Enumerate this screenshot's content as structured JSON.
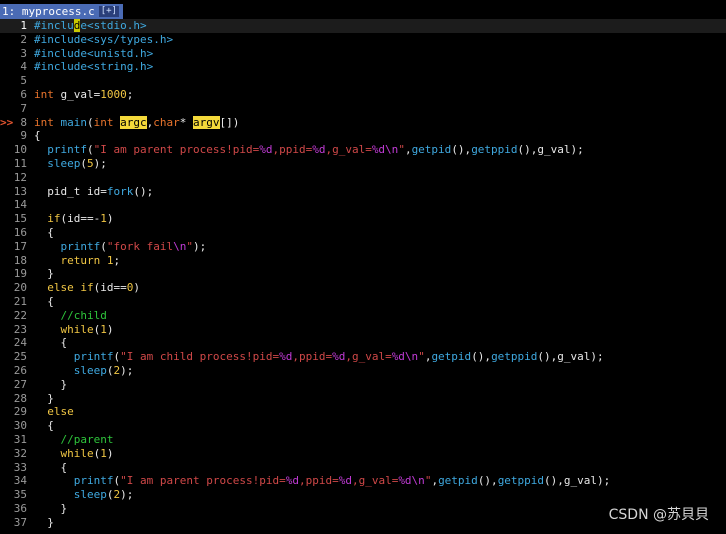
{
  "tabline": {
    "tab_label": "1: myprocess.c",
    "tab_flag": "[+]"
  },
  "editor": {
    "sign_glyph": ">>",
    "lines": [
      {
        "n": "1",
        "tokens": [
          [
            "pp",
            "#inclu"
          ],
          [
            "cur",
            "d"
          ],
          [
            "pp",
            "e"
          ],
          [
            "inc",
            "<stdio.h>"
          ]
        ]
      },
      {
        "n": "2",
        "tokens": [
          [
            "pp",
            "#include"
          ],
          [
            "inc",
            "<sys/types.h>"
          ]
        ]
      },
      {
        "n": "3",
        "tokens": [
          [
            "pp",
            "#include"
          ],
          [
            "inc",
            "<unistd.h>"
          ]
        ]
      },
      {
        "n": "4",
        "tokens": [
          [
            "pp",
            "#include"
          ],
          [
            "inc",
            "<string.h>"
          ]
        ]
      },
      {
        "n": "5",
        "tokens": []
      },
      {
        "n": "6",
        "tokens": [
          [
            "ty",
            "int"
          ],
          [
            "",
            " g_val="
          ],
          [
            "num",
            "1000"
          ],
          [
            "",
            ";"
          ]
        ]
      },
      {
        "n": "7",
        "tokens": []
      },
      {
        "n": "8",
        "sign": true,
        "tokens": [
          [
            "ty",
            "int"
          ],
          [
            "",
            " "
          ],
          [
            "fn",
            "main"
          ],
          [
            "",
            "("
          ],
          [
            "ty",
            "int"
          ],
          [
            "",
            " "
          ],
          [
            "hl",
            "argc"
          ],
          [
            "",
            ","
          ],
          [
            "ty",
            "char"
          ],
          [
            "",
            "* "
          ],
          [
            "hl",
            "argv"
          ],
          [
            "",
            "[])"
          ]
        ]
      },
      {
        "n": "9",
        "tokens": [
          [
            "",
            "{"
          ]
        ]
      },
      {
        "n": "10",
        "tokens": [
          [
            "",
            "  "
          ],
          [
            "fn",
            "printf"
          ],
          [
            "",
            "("
          ],
          [
            "str",
            "\"I am parent process!pid="
          ],
          [
            "esc",
            "%d"
          ],
          [
            "str",
            ",ppid="
          ],
          [
            "esc",
            "%d"
          ],
          [
            "str",
            ",g_val="
          ],
          [
            "esc",
            "%d\\n"
          ],
          [
            "str",
            "\""
          ],
          [
            "",
            ","
          ],
          [
            "fn",
            "getpid"
          ],
          [
            "",
            "(),"
          ],
          [
            "fn",
            "getppid"
          ],
          [
            "",
            "(),g_val);"
          ]
        ]
      },
      {
        "n": "11",
        "tokens": [
          [
            "",
            "  "
          ],
          [
            "fn",
            "sleep"
          ],
          [
            "",
            "("
          ],
          [
            "num",
            "5"
          ],
          [
            "",
            ");"
          ]
        ]
      },
      {
        "n": "12",
        "tokens": []
      },
      {
        "n": "13",
        "tokens": [
          [
            "",
            "  pid_t id="
          ],
          [
            "fn",
            "fork"
          ],
          [
            "",
            "();"
          ]
        ]
      },
      {
        "n": "14",
        "tokens": []
      },
      {
        "n": "15",
        "tokens": [
          [
            "",
            "  "
          ],
          [
            "kw",
            "if"
          ],
          [
            "",
            "(id==-"
          ],
          [
            "num",
            "1"
          ],
          [
            "",
            ")"
          ]
        ]
      },
      {
        "n": "16",
        "tokens": [
          [
            "",
            "  {"
          ]
        ]
      },
      {
        "n": "17",
        "tokens": [
          [
            "",
            "    "
          ],
          [
            "fn",
            "printf"
          ],
          [
            "",
            "("
          ],
          [
            "str",
            "\"fork fail"
          ],
          [
            "esc",
            "\\n"
          ],
          [
            "str",
            "\""
          ],
          [
            "",
            ");"
          ]
        ]
      },
      {
        "n": "18",
        "tokens": [
          [
            "",
            "    "
          ],
          [
            "kw",
            "return"
          ],
          [
            "",
            " "
          ],
          [
            "num",
            "1"
          ],
          [
            "",
            ";"
          ]
        ]
      },
      {
        "n": "19",
        "tokens": [
          [
            "",
            "  }"
          ]
        ]
      },
      {
        "n": "20",
        "tokens": [
          [
            "",
            "  "
          ],
          [
            "kw",
            "else"
          ],
          [
            "",
            " "
          ],
          [
            "kw",
            "if"
          ],
          [
            "",
            "(id=="
          ],
          [
            "num",
            "0"
          ],
          [
            "",
            ")"
          ]
        ]
      },
      {
        "n": "21",
        "tokens": [
          [
            "",
            "  {"
          ]
        ]
      },
      {
        "n": "22",
        "tokens": [
          [
            "",
            "    "
          ],
          [
            "cm",
            "//child"
          ]
        ]
      },
      {
        "n": "23",
        "tokens": [
          [
            "",
            "    "
          ],
          [
            "kw",
            "while"
          ],
          [
            "",
            "("
          ],
          [
            "num",
            "1"
          ],
          [
            "",
            ")"
          ]
        ]
      },
      {
        "n": "24",
        "tokens": [
          [
            "",
            "    {"
          ]
        ]
      },
      {
        "n": "25",
        "tokens": [
          [
            "",
            "      "
          ],
          [
            "fn",
            "printf"
          ],
          [
            "",
            "("
          ],
          [
            "str",
            "\"I am child process!pid="
          ],
          [
            "esc",
            "%d"
          ],
          [
            "str",
            ",ppid="
          ],
          [
            "esc",
            "%d"
          ],
          [
            "str",
            ",g_val="
          ],
          [
            "esc",
            "%d\\n"
          ],
          [
            "str",
            "\""
          ],
          [
            "",
            ","
          ],
          [
            "fn",
            "getpid"
          ],
          [
            "",
            "(),"
          ],
          [
            "fn",
            "getppid"
          ],
          [
            "",
            "(),g_val);"
          ]
        ]
      },
      {
        "n": "26",
        "tokens": [
          [
            "",
            "      "
          ],
          [
            "fn",
            "sleep"
          ],
          [
            "",
            "("
          ],
          [
            "num",
            "2"
          ],
          [
            "",
            ");"
          ]
        ]
      },
      {
        "n": "27",
        "tokens": [
          [
            "",
            "    }"
          ]
        ]
      },
      {
        "n": "28",
        "tokens": [
          [
            "",
            "  }"
          ]
        ]
      },
      {
        "n": "29",
        "tokens": [
          [
            "",
            "  "
          ],
          [
            "kw",
            "else"
          ]
        ]
      },
      {
        "n": "30",
        "tokens": [
          [
            "",
            "  {"
          ]
        ]
      },
      {
        "n": "31",
        "tokens": [
          [
            "",
            "    "
          ],
          [
            "cm",
            "//parent"
          ]
        ]
      },
      {
        "n": "32",
        "tokens": [
          [
            "",
            "    "
          ],
          [
            "kw",
            "while"
          ],
          [
            "",
            "("
          ],
          [
            "num",
            "1"
          ],
          [
            "",
            ")"
          ]
        ]
      },
      {
        "n": "33",
        "tokens": [
          [
            "",
            "    {"
          ]
        ]
      },
      {
        "n": "34",
        "tokens": [
          [
            "",
            "      "
          ],
          [
            "fn",
            "printf"
          ],
          [
            "",
            "("
          ],
          [
            "str",
            "\"I am parent process!pid="
          ],
          [
            "esc",
            "%d"
          ],
          [
            "str",
            ",ppid="
          ],
          [
            "esc",
            "%d"
          ],
          [
            "str",
            ",g_val="
          ],
          [
            "esc",
            "%d\\n"
          ],
          [
            "str",
            "\""
          ],
          [
            "",
            ","
          ],
          [
            "fn",
            "getpid"
          ],
          [
            "",
            "(),"
          ],
          [
            "fn",
            "getppid"
          ],
          [
            "",
            "(),g_val);"
          ]
        ]
      },
      {
        "n": "35",
        "tokens": [
          [
            "",
            "      "
          ],
          [
            "fn",
            "sleep"
          ],
          [
            "",
            "("
          ],
          [
            "num",
            "2"
          ],
          [
            "",
            ");"
          ]
        ]
      },
      {
        "n": "36",
        "tokens": [
          [
            "",
            "    }"
          ]
        ]
      },
      {
        "n": "37",
        "tokens": [
          [
            "",
            "  }"
          ]
        ]
      }
    ]
  },
  "watermark": "CSDN @苏貝貝",
  "colors": {
    "background": "#000000",
    "tab_bg": "#4a6bb5",
    "preprocessor": "#3fa9e0",
    "keyword": "#f0c644",
    "type": "#e8732c",
    "string": "#d04848",
    "escape": "#c13bd6",
    "comment": "#2ec43b",
    "search_highlight": "#f4d93a"
  }
}
